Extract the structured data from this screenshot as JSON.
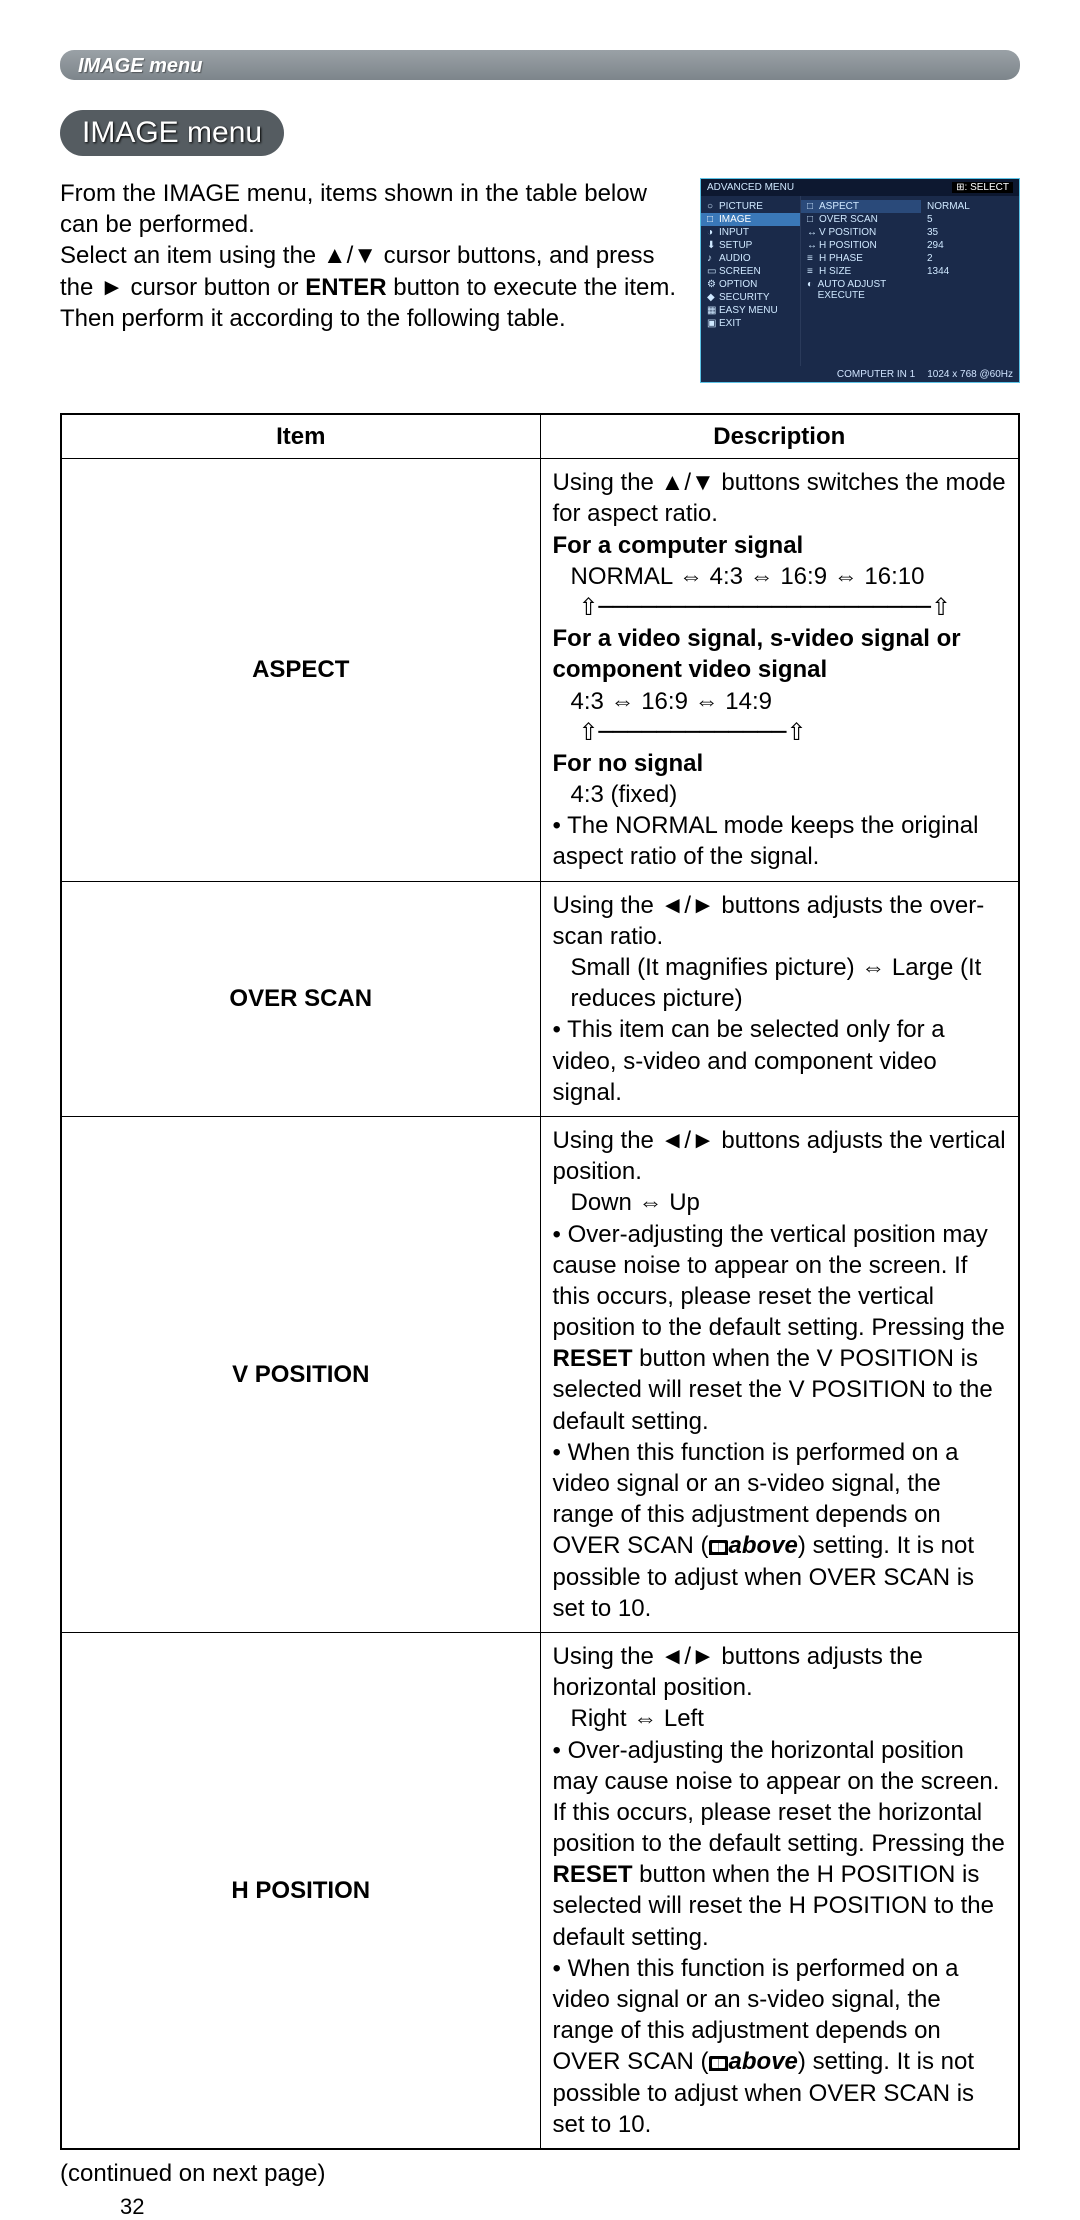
{
  "header_bar": "IMAGE menu",
  "title_pill": "IMAGE menu",
  "intro_pre": "From the IMAGE menu, items shown in the table below can be performed.",
  "intro_select": "Select an item using the ▲/▼ cursor buttons, and press the ► cursor button or ",
  "intro_enter": "ENTER",
  "intro_post": " button to execute the item. Then perform it according to the following table.",
  "osd": {
    "title_left": "ADVANCED MENU",
    "title_right": "⊞: SELECT",
    "left": [
      "PICTURE",
      "IMAGE",
      "INPUT",
      "SETUP",
      "AUDIO",
      "SCREEN",
      "OPTION",
      "SECURITY",
      "EASY MENU",
      "EXIT"
    ],
    "mid": [
      "ASPECT",
      "OVER SCAN",
      "V POSITION",
      "H POSITION",
      "H PHASE",
      "H SIZE",
      "AUTO ADJUST EXECUTE"
    ],
    "right": [
      "NORMAL",
      "5",
      "35",
      "294",
      "2",
      "1344",
      ""
    ],
    "left_sel": 1,
    "mid_sel": 0,
    "footer_source": "COMPUTER IN 1",
    "footer_res": "1024 x 768 @60Hz"
  },
  "table": {
    "col_item": "Item",
    "col_desc": "Description",
    "rows": [
      {
        "item": "ASPECT",
        "line1": "Using the ▲/▼ buttons switches the mode for aspect ratio.",
        "sub1_title": "For a computer signal",
        "sub1_seq": "NORMAL ⇔ 4:3 ⇔ 16:9 ⇔ 16:10",
        "sub1_cycle": "⇧───────────────────────⇧",
        "sub2_title": "For a video signal, s-video signal or component video signal",
        "sub2_seq": "4:3 ⇔ 16:9 ⇔ 14:9",
        "sub2_cycle": "⇧─────────────⇧",
        "sub3_title": "For no signal",
        "sub3_seq": "4:3 (fixed)",
        "note": "• The NORMAL mode keeps the original aspect ratio of the signal."
      },
      {
        "item": "OVER SCAN",
        "line1": "Using the ◄/► buttons adjusts the over-scan ratio.",
        "seq": "Small (It magnifies picture) ⇔ Large (It reduces picture)",
        "note": "• This item can be selected only for a video, s-video and component video signal."
      },
      {
        "item": "V POSITION",
        "line1": "Using the ◄/► buttons adjusts the vertical position.",
        "seq": "Down ⇔ Up",
        "bullet1_pre": "• Over-adjusting the vertical position may cause noise to appear on the screen. If this occurs, please reset the vertical position to the default setting. Pressing the ",
        "bullet1_reset": "RESET",
        "bullet1_post": " button when the V POSITION is selected will reset the V POSITION to the default setting.",
        "bullet2_pre": "• When this function is performed on a video signal or an s-video signal, the range of this adjustment depends on OVER SCAN (",
        "bullet2_above": "above",
        "bullet2_post": ") setting. It is not possible to adjust when OVER SCAN is set to 10."
      },
      {
        "item": "H POSITION",
        "line1": "Using the ◄/► buttons adjusts the horizontal position.",
        "seq": "Right ⇔ Left",
        "bullet1_pre": "• Over-adjusting the horizontal position may cause noise to appear on the screen. If this occurs, please reset the horizontal position to the default setting. Pressing the ",
        "bullet1_reset": "RESET",
        "bullet1_post": " button when the H POSITION is selected will reset the H POSITION to the default setting.",
        "bullet2_pre": "• When this function is performed on a video signal or an s-video signal, the range of this adjustment depends on OVER SCAN (",
        "bullet2_above": "above",
        "bullet2_post": ") setting. It is not possible to adjust when OVER SCAN is set to 10."
      }
    ]
  },
  "continued": "(continued on next page)",
  "page_num": "32"
}
